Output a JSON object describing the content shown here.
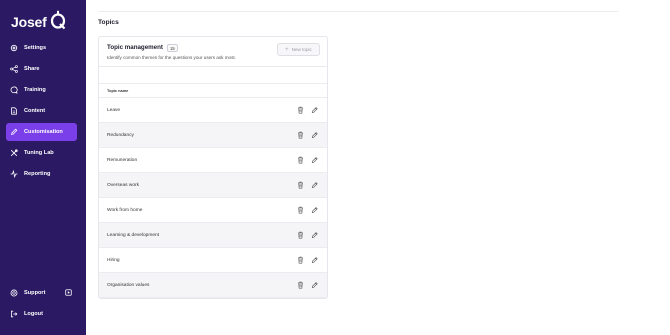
{
  "app": {
    "logo": "Josef"
  },
  "sidebar": {
    "items": [
      {
        "label": "Settings",
        "icon": "gear-icon"
      },
      {
        "label": "Share",
        "icon": "share-icon"
      },
      {
        "label": "Training",
        "icon": "chat-bubble-icon"
      },
      {
        "label": "Content",
        "icon": "document-icon"
      },
      {
        "label": "Customisation",
        "icon": "pencil-icon",
        "active": true
      },
      {
        "label": "Tuning Lab",
        "icon": "tools-icon"
      },
      {
        "label": "Reporting",
        "icon": "activity-icon"
      }
    ],
    "bottom": [
      {
        "label": "Support",
        "icon": "lifebuoy-icon"
      },
      {
        "label": "Logout",
        "icon": "logout-icon"
      }
    ]
  },
  "page": {
    "title": "Topics"
  },
  "card": {
    "title": "Topic management",
    "count": "15",
    "subtitle": "Identify common themes for the questions your users ask most.",
    "new_button": "New topic",
    "column_header": "Topic name",
    "topics": [
      "Leave",
      "Redundancy",
      "Remuneration",
      "Overseas work",
      "Work from home",
      "Learning & development",
      "Hiring",
      "Organisation values"
    ]
  },
  "colors": {
    "sidebar_bg": "#2b1a63",
    "active_bg": "#7a3fe8"
  }
}
